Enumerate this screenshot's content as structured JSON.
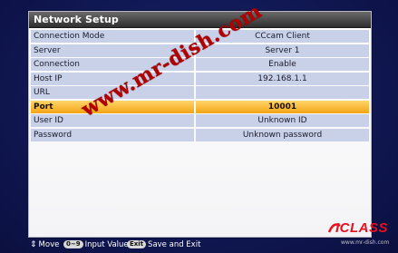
{
  "window": {
    "title": "Network Setup"
  },
  "rows": [
    {
      "label": "Connection Mode",
      "value": "CCcam Client",
      "selected": false
    },
    {
      "label": "Server",
      "value": "Server 1",
      "selected": false
    },
    {
      "label": "Connection",
      "value": "Enable",
      "selected": false
    },
    {
      "label": "Host IP",
      "value": "192.168.1.1",
      "selected": false
    },
    {
      "label": "URL",
      "value": "",
      "selected": false
    },
    {
      "label": "Port",
      "value": "10001",
      "selected": true
    },
    {
      "label": "User ID",
      "value": "Unknown ID",
      "selected": false
    },
    {
      "label": "Password",
      "value": "Unknown password",
      "selected": false
    }
  ],
  "watermark": {
    "text": "www.mr-dish.com",
    "color": "#b00000"
  },
  "footer": {
    "move_label": "Move",
    "input_key": "0~9",
    "input_label": "Input Value",
    "exit_key": "Exit",
    "exit_label": "Save and Exit"
  },
  "brand": {
    "name": "ICLASS",
    "url": "www.mr-dish.com",
    "color": "#e8101c"
  },
  "colors": {
    "selected_row": "#f3a414",
    "row_bg": "#c9d1e9",
    "header_bg": "#3a3a3a"
  }
}
